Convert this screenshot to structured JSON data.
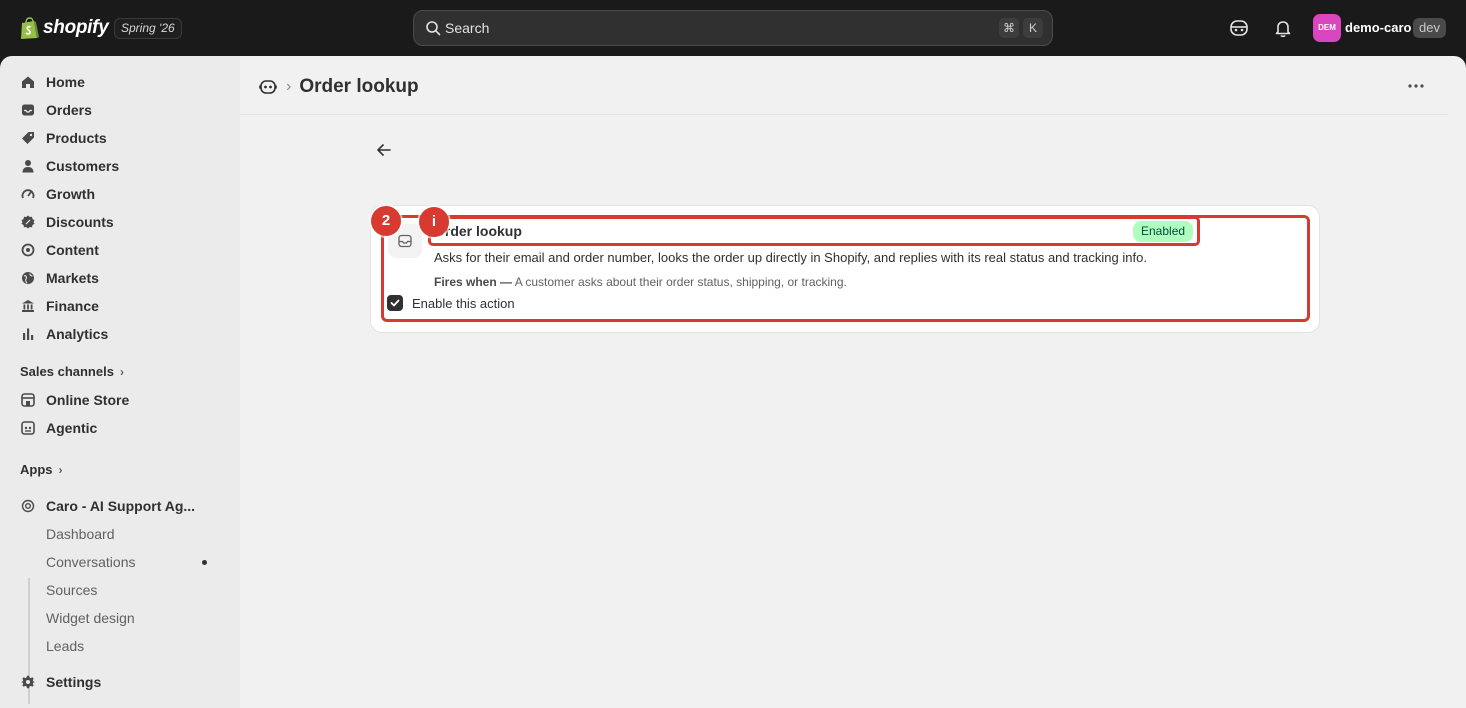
{
  "topbar": {
    "brand": "shopify",
    "edition": "Spring '26",
    "search_placeholder": "Search",
    "shortcut_cmd": "⌘",
    "shortcut_key": "K",
    "avatar_initials": "DEM",
    "store_name": "demo-caro",
    "store_badge": "dev"
  },
  "sidebar": {
    "items": [
      {
        "label": "Home",
        "icon": "home-icon"
      },
      {
        "label": "Orders",
        "icon": "inbox-icon"
      },
      {
        "label": "Products",
        "icon": "tag-icon"
      },
      {
        "label": "Customers",
        "icon": "person-icon"
      },
      {
        "label": "Growth",
        "icon": "gauge-icon"
      },
      {
        "label": "Discounts",
        "icon": "discount-icon"
      },
      {
        "label": "Content",
        "icon": "content-icon"
      },
      {
        "label": "Markets",
        "icon": "globe-icon"
      },
      {
        "label": "Finance",
        "icon": "bank-icon"
      },
      {
        "label": "Analytics",
        "icon": "bar-chart-icon"
      }
    ],
    "sales_channels_label": "Sales channels",
    "channels": [
      {
        "label": "Online Store",
        "icon": "store-icon"
      },
      {
        "label": "Agentic",
        "icon": "agent-icon"
      }
    ],
    "apps_label": "Apps",
    "app": {
      "label": "Caro - AI Support Ag...",
      "icon": "app-icon"
    },
    "app_subitems": [
      "Dashboard",
      "Conversations",
      "Sources",
      "Widget design",
      "Leads"
    ],
    "settings_label": "Settings"
  },
  "page": {
    "title": "Order lookup"
  },
  "action_card": {
    "title": "Order lookup",
    "status": "Enabled",
    "description": "Asks for their email and order number, looks the order up directly in Shopify, and replies with its real status and tracking info.",
    "fires_label": "Fires when —",
    "fires_text": "A customer asks about their order status, shipping, or tracking.",
    "checkbox_label": "Enable this action",
    "checkbox_checked": true,
    "marker_outer": "2",
    "marker_inner": "i"
  },
  "colors": {
    "highlight": "#d63a30",
    "badge_bg": "#affebf",
    "avatar": "#d946c0"
  }
}
